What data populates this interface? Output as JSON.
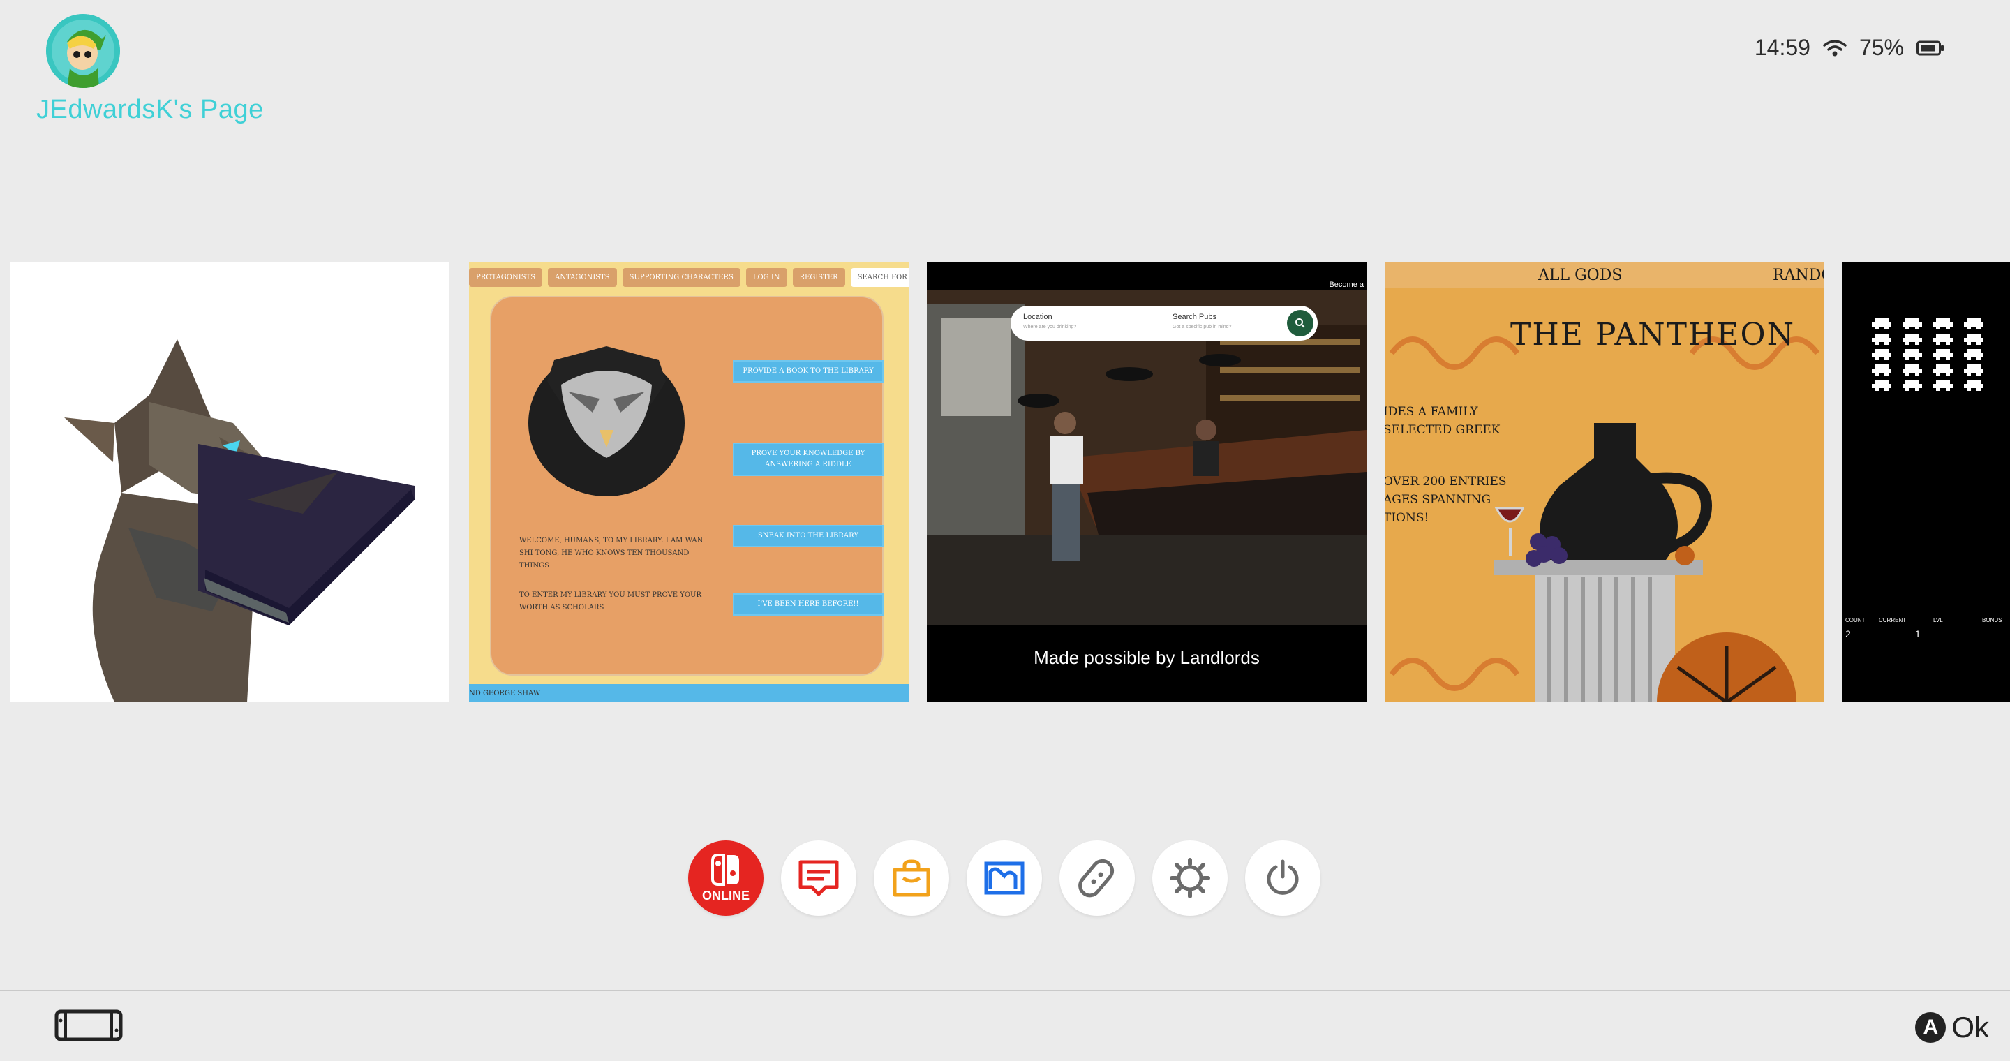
{
  "header": {
    "user_name": "JEdwardsK's Page",
    "avatar_icon": "link-character-avatar"
  },
  "status": {
    "time": "14:59",
    "battery": "75%",
    "wifi_icon": "wifi-icon",
    "battery_icon": "battery-icon"
  },
  "tiles": [
    {
      "name": "wolf-with-book",
      "icon": "wolf-holding-book-illustration"
    },
    {
      "name": "library-site",
      "nav": [
        "PROTAGONISTS",
        "ANTAGONISTS",
        "SUPPORTING CHARACTERS",
        "LOG IN",
        "REGISTER",
        "SEARCH FOR"
      ],
      "buttons": [
        "PROVIDE A BOOK TO THE LIBRARY",
        "PROVE YOUR KNOWLEDGE BY ANSWERING A RIDDLE",
        "SNEAK INTO THE LIBRARY",
        "I'VE BEEN HERE BEFORE!!"
      ],
      "welcome": "WELCOME, HUMANS, TO MY LIBRARY. I AM WAN SHI TONG, HE WHO KNOWS TEN THOUSAND THINGS",
      "enter": "TO ENTER MY LIBRARY YOU MUST PROVE YOUR WORTH AS SCHOLARS",
      "footer": "ND GEORGE SHAW"
    },
    {
      "name": "pub-site",
      "become": "Become a",
      "location_label": "Location",
      "location_hint": "Where are you drinking?",
      "search_label": "Search Pubs",
      "search_hint": "Got a specific pub in mind?",
      "caption": "Made possible by Landlords"
    },
    {
      "name": "pantheon-site",
      "nav_left": "ALL GODS",
      "nav_right": "RANDO",
      "title": "THE PANTHEON",
      "line1": "IDES A FAMILY",
      "line2": "SELECTED GREEK",
      "line3": "OVER 200 ENTRIES",
      "line4": "AGES SPANNING",
      "line5": "TIONS!"
    },
    {
      "name": "space-invaders",
      "labels": [
        "COUNT",
        "CURRENT",
        "LVL",
        "BONUS"
      ],
      "values": [
        "2",
        "1"
      ]
    }
  ],
  "dock": [
    {
      "name": "nintendo-switch-online",
      "label": "ONLINE",
      "color": "#e52521"
    },
    {
      "name": "news",
      "color": "#e52521"
    },
    {
      "name": "eshop",
      "color": "#f2a21b"
    },
    {
      "name": "album",
      "color": "#1e6fe8"
    },
    {
      "name": "controllers",
      "color": "#6b6b6b"
    },
    {
      "name": "system-settings",
      "color": "#6b6b6b"
    },
    {
      "name": "power",
      "color": "#6b6b6b"
    }
  ],
  "footer": {
    "ok_label": "Ok",
    "a_button": "A",
    "handheld_icon": "handheld-mode-icon"
  }
}
